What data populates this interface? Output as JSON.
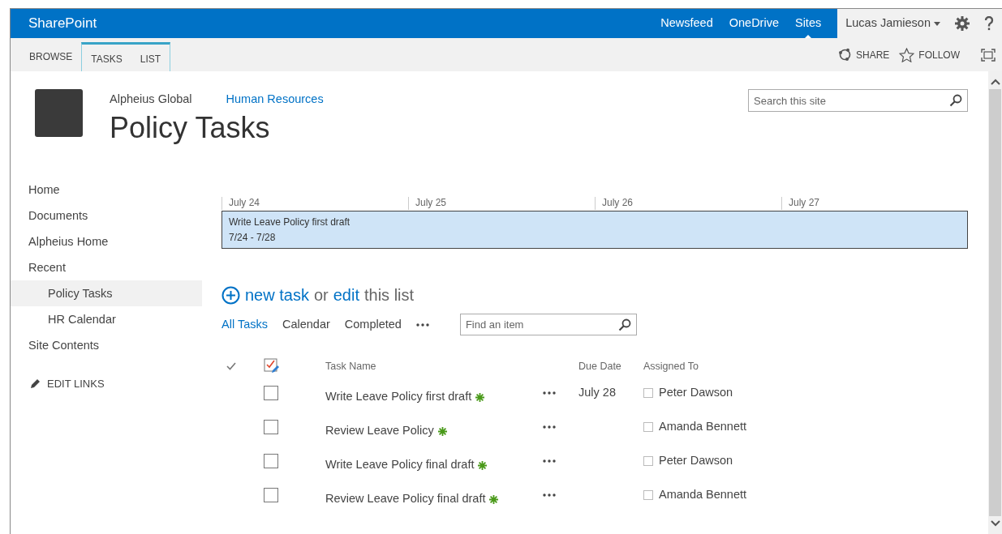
{
  "suite_bar": {
    "brand": "SharePoint",
    "links": [
      {
        "label": "Newsfeed",
        "selected": false
      },
      {
        "label": "OneDrive",
        "selected": false
      },
      {
        "label": "Sites",
        "selected": true
      }
    ],
    "user": "Lucas Jamieson"
  },
  "ribbon": {
    "tabs": [
      {
        "label": "BROWSE",
        "contextual": false
      },
      {
        "label": "TASKS",
        "contextual": true
      },
      {
        "label": "LIST",
        "contextual": true
      }
    ],
    "actions": [
      {
        "kind": "share",
        "label": "SHARE"
      },
      {
        "kind": "follow",
        "label": "FOLLOW"
      }
    ]
  },
  "site": {
    "parent": "Alpheius Global",
    "link": "Human Resources",
    "title": "Policy Tasks",
    "search": {
      "placeholder": "Search this site"
    }
  },
  "sidebar": {
    "items": [
      {
        "label": "Home",
        "selected": false
      },
      {
        "label": "Documents",
        "selected": false
      },
      {
        "label": "Alpheius Home",
        "selected": false
      },
      {
        "label": "Recent",
        "selected": false,
        "children": [
          {
            "label": "Policy Tasks",
            "selected": true
          },
          {
            "label": "HR Calendar",
            "selected": false
          }
        ]
      },
      {
        "label": "Site Contents",
        "selected": false
      }
    ],
    "edit_links": "EDIT LINKS"
  },
  "timeline": {
    "dates": [
      "July 24",
      "July 25",
      "July 26",
      "July 27"
    ],
    "task": {
      "title": "Write Leave Policy first draft",
      "range": "7/24 - 7/28"
    }
  },
  "list": {
    "new_task": {
      "parts": [
        {
          "text": "new task",
          "link": true
        },
        {
          "text": "or",
          "link": false
        },
        {
          "text": "edit",
          "link": true
        },
        {
          "text": "this list",
          "link": false
        }
      ]
    },
    "views": [
      {
        "label": "All Tasks",
        "selected": true
      },
      {
        "label": "Calendar",
        "selected": false
      },
      {
        "label": "Completed",
        "selected": false
      }
    ],
    "find": {
      "placeholder": "Find an item"
    },
    "columns": [
      "Task Name",
      "Due Date",
      "Assigned To"
    ],
    "rows": [
      {
        "checked": false,
        "name": "Write Leave Policy first draft",
        "is_new": true,
        "due": "July 28",
        "assigned": "Peter Dawson"
      },
      {
        "checked": false,
        "name": "Review Leave Policy",
        "is_new": true,
        "assigned": "Amanda Bennett"
      },
      {
        "checked": false,
        "name": "Write Leave Policy final draft",
        "is_new": true,
        "assigned": "Peter Dawson"
      },
      {
        "checked": false,
        "name": "Review Leave Policy final draft",
        "is_new": true,
        "assigned": "Amanda Bennett"
      }
    ]
  }
}
